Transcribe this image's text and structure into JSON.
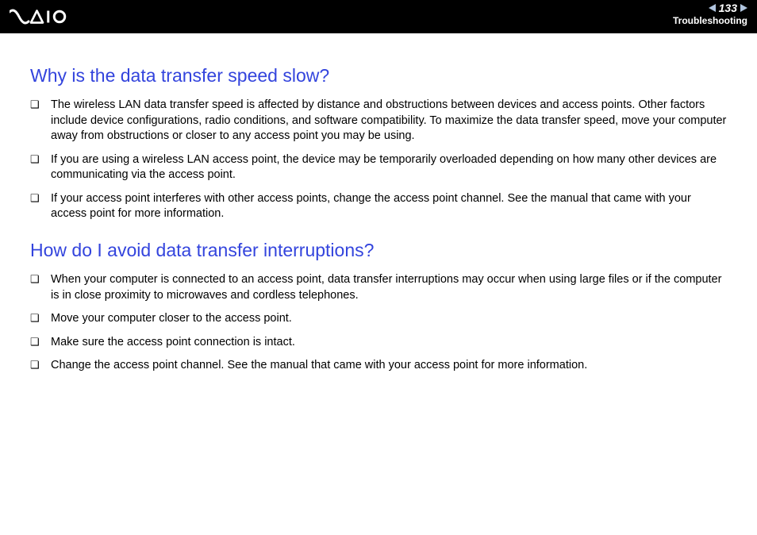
{
  "header": {
    "page_number": "133",
    "section": "Troubleshooting"
  },
  "sections": [
    {
      "heading": "Why is the data transfer speed slow?",
      "items": [
        "The wireless LAN data transfer speed is affected by distance and obstructions between devices and access points. Other factors include device configurations, radio conditions, and software compatibility. To maximize the data transfer speed, move your computer away from obstructions or closer to any access point you may be using.",
        "If you are using a wireless LAN access point, the device may be temporarily overloaded depending on how many other devices are communicating via the access point.",
        "If your access point interferes with other access points, change the access point channel. See the manual that came with your access point for more information."
      ]
    },
    {
      "heading": "How do I avoid data transfer interruptions?",
      "items": [
        "When your computer is connected to an access point, data transfer interruptions may occur when using large files or if the computer is in close proximity to microwaves and cordless telephones.",
        "Move your computer closer to the access point.",
        "Make sure the access point connection is intact.",
        "Change the access point channel. See the manual that came with your access point for more information."
      ]
    }
  ]
}
